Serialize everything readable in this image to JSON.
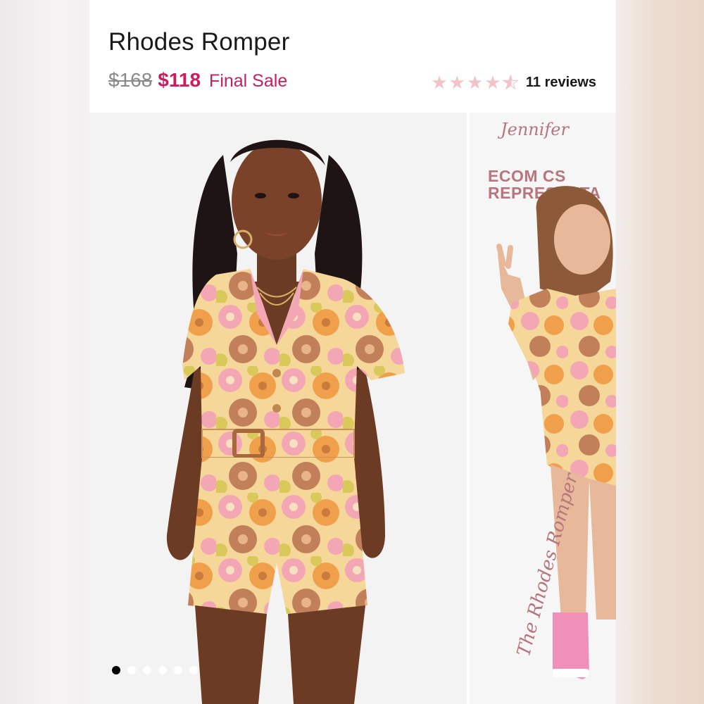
{
  "product": {
    "title": "Rhodes Romper",
    "original_price": "$168",
    "sale_price": "$118",
    "sale_note": "Final Sale",
    "rating_value": 4.5,
    "rating_max": 5,
    "reviews_label": "11 reviews"
  },
  "gallery": {
    "slide_count": 6,
    "active_index": 0,
    "next_slide": {
      "signature": "Jennifer",
      "label_line1": "ECOM CS",
      "label_line2": "REPRESENTA",
      "script_text": "The Rhodes Romper"
    }
  },
  "colors": {
    "accent": "#c81d5e",
    "star": "#f2c3c8",
    "promo": "#b7767d"
  },
  "icons": {
    "rating": "star-icon"
  }
}
